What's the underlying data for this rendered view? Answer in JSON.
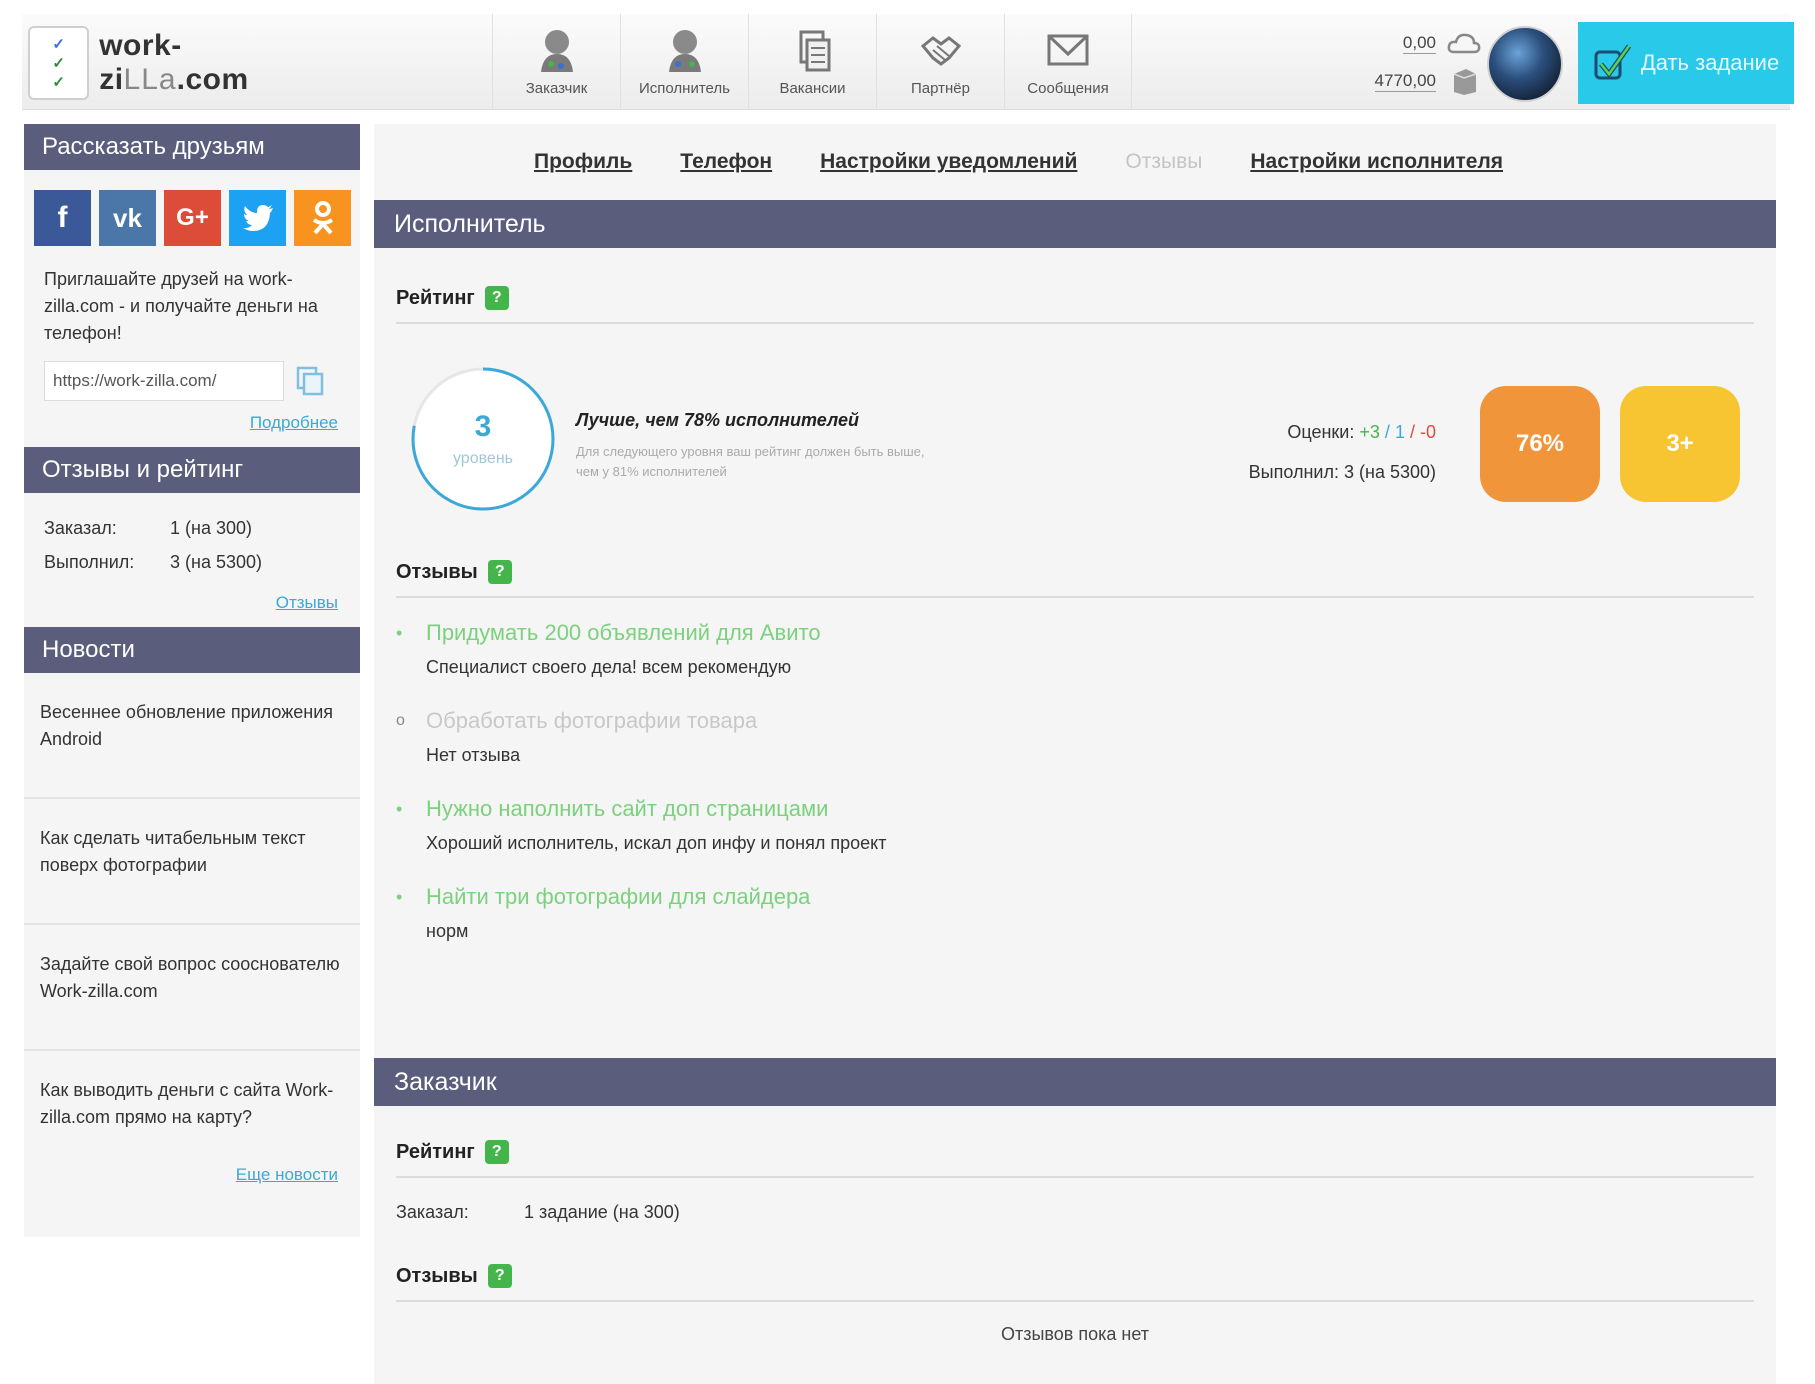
{
  "header": {
    "logo_text_main": "work-zi",
    "logo_text_thin": "LLa",
    "logo_text_end": ".com",
    "nav": [
      {
        "label": "Заказчик",
        "icon": "customer-icon"
      },
      {
        "label": "Исполнитель",
        "icon": "performer-icon"
      },
      {
        "label": "Вакансии",
        "icon": "vacancies-icon"
      },
      {
        "label": "Партнёр",
        "icon": "partner-icon"
      },
      {
        "label": "Сообщения",
        "icon": "messages-icon"
      }
    ],
    "balance_top": "0,00",
    "balance_bottom": "4770,00",
    "give_task_label": "Дать задание"
  },
  "sidebar": {
    "share": {
      "title": "Рассказать друзьям",
      "social": [
        {
          "label": "f",
          "icon": "facebook-icon"
        },
        {
          "label": "vk",
          "icon": "vk-icon"
        },
        {
          "label": "G+",
          "icon": "google-plus-icon"
        },
        {
          "label": "t",
          "icon": "twitter-icon"
        },
        {
          "label": "ok",
          "icon": "odnoklassniki-icon"
        }
      ],
      "invite_text": "Приглашайте друзей на work-zilla.com - и получайте деньги на телефон!",
      "ref_link": "https://work-zilla.com/",
      "more_link": "Подробнее"
    },
    "reviews": {
      "title": "Отзывы и рейтинг",
      "ordered_key": "Заказал:",
      "ordered_val": "1 (на 300)",
      "done_key": "Выполнил:",
      "done_val": "3 (на 5300)",
      "link": "Отзывы"
    },
    "news": {
      "title": "Новости",
      "items": [
        "Весеннее обновление приложения Android",
        "Как сделать читабельным текст поверх фотографии",
        "Задайте свой вопрос сооснователю Work-zilla.com",
        "Как выводить деньги с сайта Work-zilla.com прямо на карту?"
      ],
      "more_link": "Еще новости"
    }
  },
  "main": {
    "tabs": [
      "Профиль",
      "Телефон",
      "Настройки уведомлений",
      "Отзывы",
      "Настройки исполнителя"
    ],
    "performer": {
      "title": "Исполнитель",
      "rating_label": "Рейтинг",
      "level_number": "3",
      "level_label": "уровень",
      "level_progress": 0.78,
      "better_than": "Лучше, чем 78% исполнителей",
      "better_note": "Для следующего уровня ваш рейтинг должен быть выше, чем у 81% исполнителей",
      "scores_key": "Оценки:",
      "score_pos": "+3",
      "score_neu": "1",
      "score_neg": "-0",
      "done_key": "Выполнил:",
      "done_val": "3 (на 5300)",
      "badge_percent": "76%",
      "badge_level": "3+",
      "reviews_label": "Отзывы",
      "reviews": [
        {
          "title": "Придумать 200 объявлений для Авито",
          "text": "Специалист своего дела! всем рекомендую",
          "marker": "•",
          "positive": true
        },
        {
          "title": "Обработать фотографии товара",
          "text": "Нет отзыва",
          "marker": "o",
          "positive": false
        },
        {
          "title": "Нужно наполнить сайт доп страницами",
          "text": "Хороший исполнитель, искал доп инфу и понял проект",
          "marker": "•",
          "positive": true
        },
        {
          "title": "Найти три фотографии для слайдера",
          "text": "норм",
          "marker": "•",
          "positive": true
        }
      ]
    },
    "customer": {
      "title": "Заказчик",
      "rating_label": "Рейтинг",
      "ordered_key": "Заказал:",
      "ordered_val": "1 задание (на 300)",
      "reviews_label": "Отзывы",
      "no_reviews": "Отзывов пока нет"
    }
  },
  "colors": {
    "header_bar": "#5a5e7c",
    "accent_blue": "#29c9ea",
    "green": "#44b54a",
    "orange_badge": "#f0953a",
    "yellow_badge": "#f6c531"
  }
}
